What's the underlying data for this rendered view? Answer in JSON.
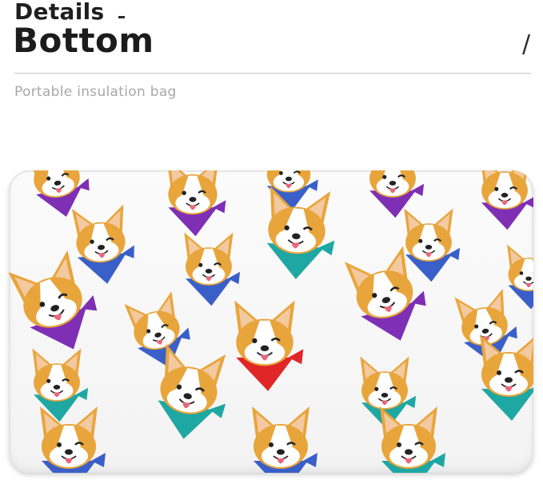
{
  "header": {
    "title_small": "Details",
    "title_big": "Bottom",
    "slash": "/",
    "subtitle": "Portable insulation bag"
  },
  "product": {
    "description_icon": "corgi-pattern-mat",
    "pattern_colors": {
      "fur": "#E8A53B",
      "fur_light": "#FFFFFF",
      "ear_inner": "#F3C9A0",
      "tongue": "#E8677B",
      "bandana_purple": "#7E2FB4",
      "bandana_blue": "#3A5FC8",
      "bandana_teal": "#1FA7A3",
      "bandana_red": "#E02626"
    }
  }
}
